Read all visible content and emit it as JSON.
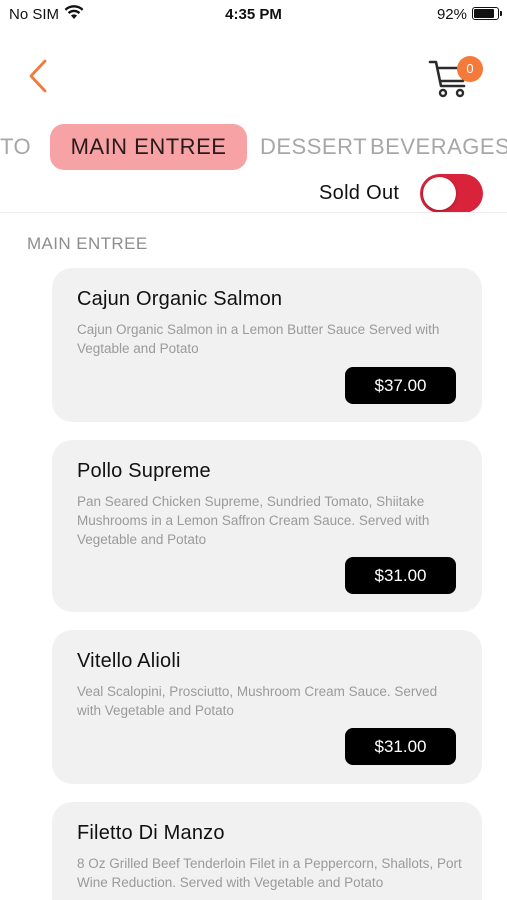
{
  "status_bar": {
    "carrier": "No SIM",
    "time": "4:35 PM",
    "battery_percent": "92%",
    "battery_level": 0.92
  },
  "nav": {
    "back_icon": "chevron-left-icon",
    "cart_icon": "cart-icon",
    "cart_count": "0"
  },
  "tabs": [
    {
      "label": "TTO",
      "active": false
    },
    {
      "label": "MAIN ENTREE",
      "active": true
    },
    {
      "label": "DESSERT",
      "active": false
    },
    {
      "label": "BEVERAGES (",
      "active": false
    }
  ],
  "sold_out": {
    "label": "Sold Out",
    "enabled": false
  },
  "section": {
    "title": "MAIN ENTREE"
  },
  "items": [
    {
      "name": "Cajun Organic Salmon",
      "description": "Cajun Organic Salmon in a Lemon Butter Sauce Served with Vegtable and Potato",
      "price": "$37.00"
    },
    {
      "name": "Pollo Supreme",
      "description": "Pan Seared Chicken Supreme, Sundried Tomato, Shiitake Mushrooms in a Lemon Saffron Cream Sauce. Served with Vegetable and Potato",
      "price": "$31.00"
    },
    {
      "name": "Vitello Alioli",
      "description": "Veal Scalopini, Prosciutto, Mushroom Cream Sauce. Served with Vegetable and Potato",
      "price": "$31.00"
    },
    {
      "name": "Filetto Di Manzo",
      "description": "8 Oz Grilled Beef Tenderloin Filet in a Peppercorn, Shallots, Port Wine Reduction. Served with Vegetable and Potato",
      "price": ""
    }
  ],
  "colors": {
    "accent_orange": "#f37a3b",
    "tab_active_bg": "#f7a3a6",
    "toggle_red": "#d9233a",
    "price_bg": "#000000",
    "card_bg": "#f1f1f1"
  }
}
